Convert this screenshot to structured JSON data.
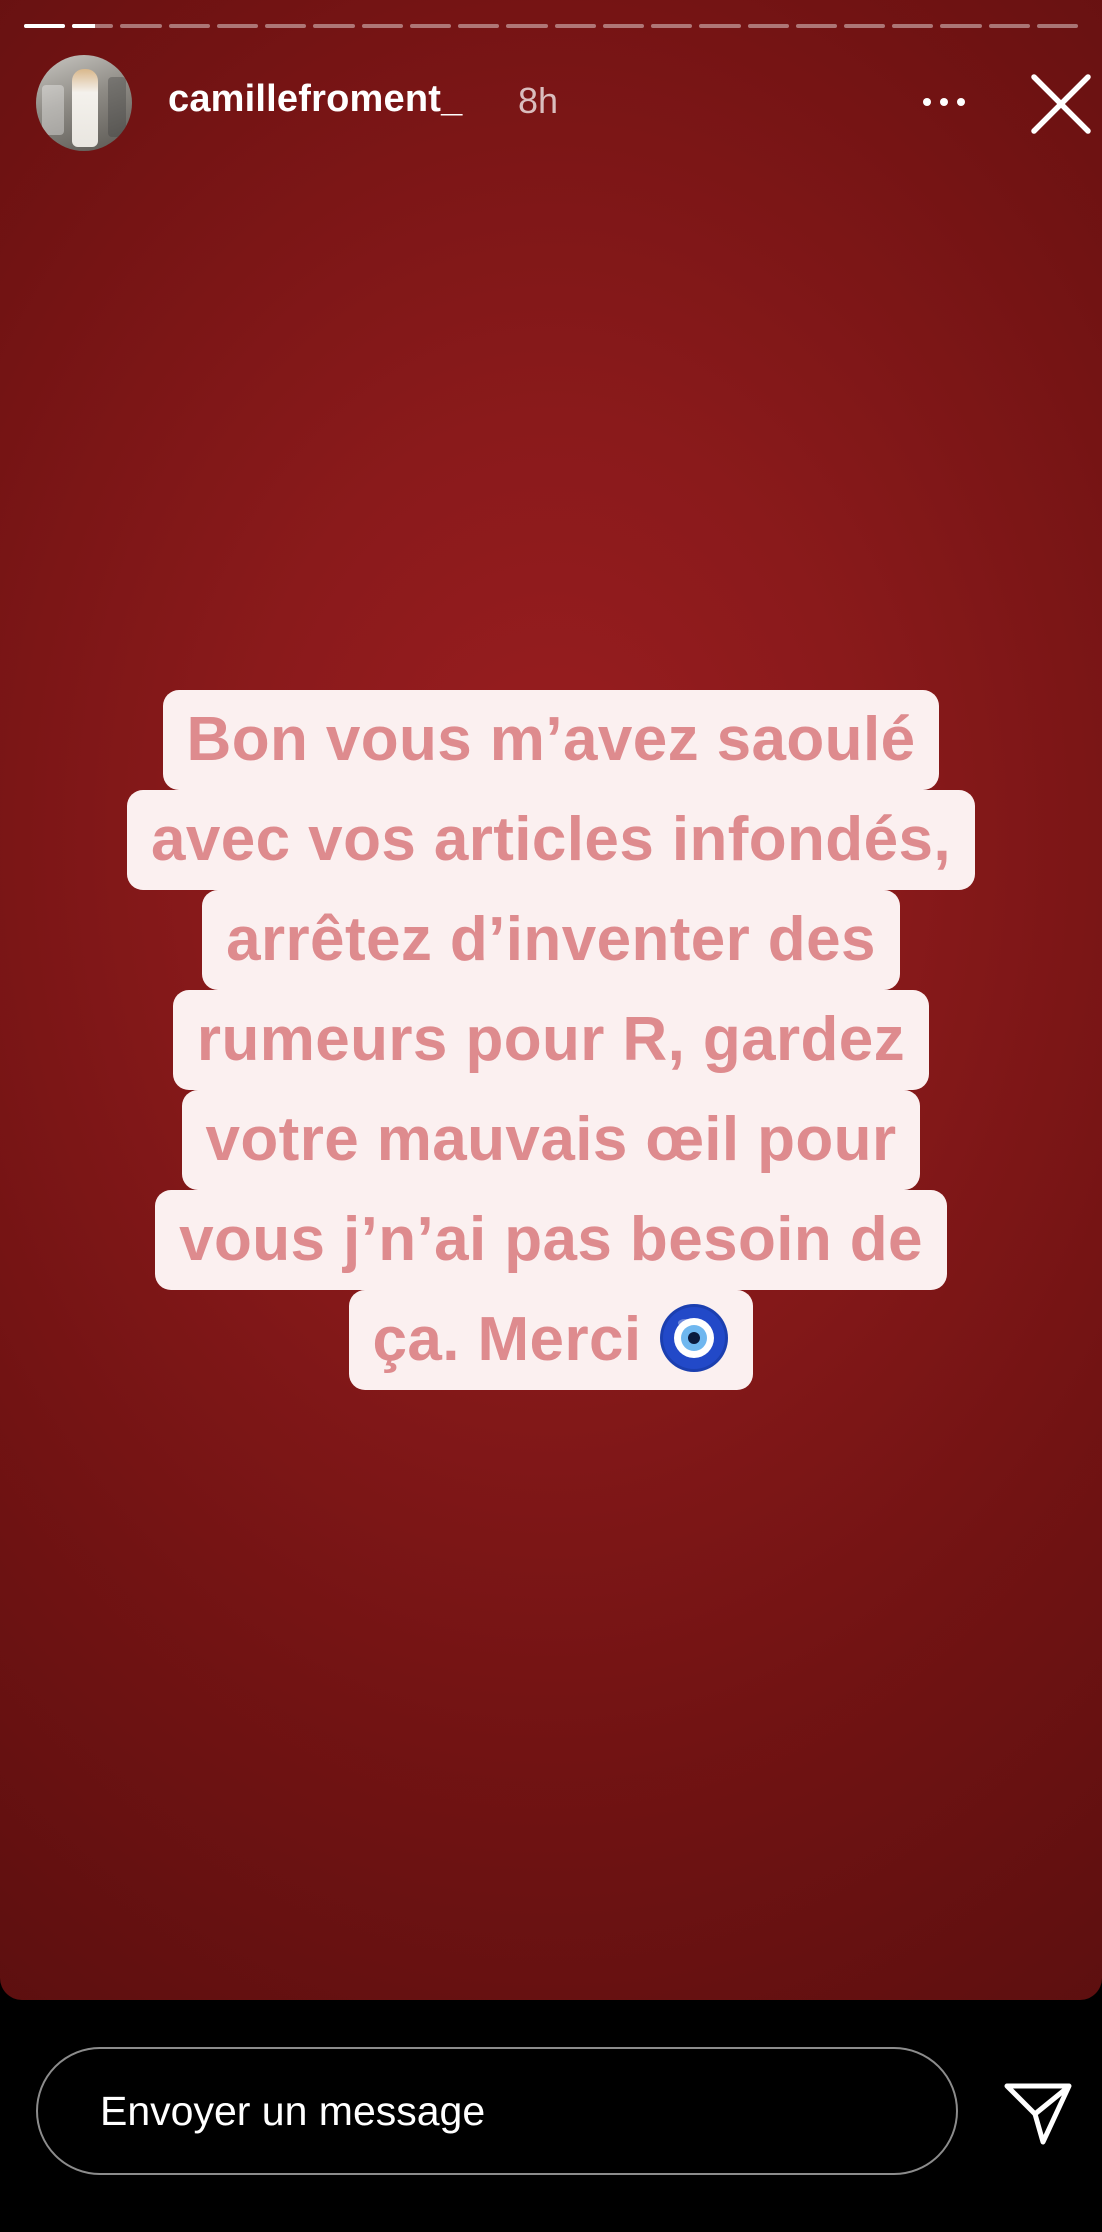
{
  "story": {
    "user": {
      "username": "camillefroment_",
      "time_ago": "8h"
    },
    "progress": {
      "segment_count": 22,
      "active_index": 1,
      "active_fraction": 0.55
    },
    "caption_lines": [
      "Bon vous m’avez saoulé",
      "avec vos articles infondés,",
      "arrêtez d’inventer des",
      "rumeurs pour R, gardez",
      "votre mauvais œil pour",
      "vous j’n’ai pas besoin de",
      "ça. Merci"
    ],
    "caption_emoji": "nazar-amulet",
    "colors": {
      "background": "#8a1a1b",
      "text_box": "#fbf0f0",
      "text": "#de8b8e"
    }
  },
  "reply": {
    "placeholder": "Envoyer un message"
  },
  "icons": {
    "more": "more-dots-icon",
    "close": "close-icon",
    "send": "send-paper-plane-icon"
  }
}
